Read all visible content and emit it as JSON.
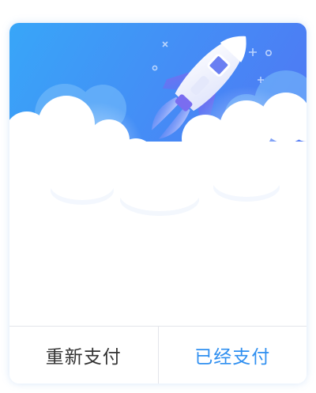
{
  "dialog": {
    "colors": {
      "hero_gradient_start": "#3aa0f7",
      "hero_gradient_end": "#4f78f5",
      "primary_action": "#2f8ff0",
      "secondary_action": "#333333",
      "divider": "#e3e5ea"
    },
    "illustration": {
      "icon": "rocket-icon",
      "decorations": [
        "cloud",
        "sparkle",
        "circle"
      ]
    },
    "actions": {
      "repay_label": "重新支付",
      "paid_label": "已经支付"
    }
  }
}
